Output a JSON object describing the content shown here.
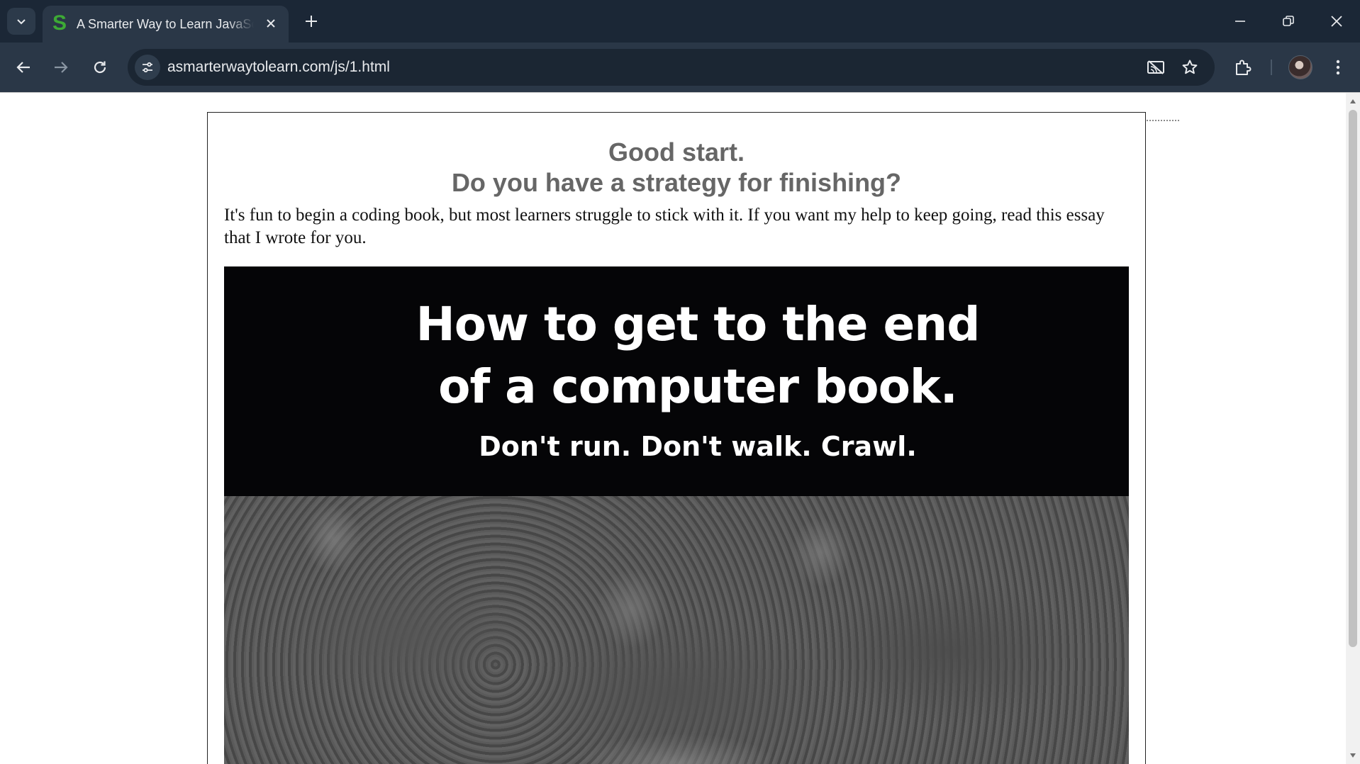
{
  "browser": {
    "tab": {
      "favicon": "S",
      "title": "A Smarter Way to Learn JavaScript"
    },
    "url": "asmarterwaytolearn.com/js/1.html",
    "icons": {
      "tab_search": "chevron-down-icon",
      "tab_close": "close-icon",
      "new_tab": "plus-icon",
      "minimize": "minimize-icon",
      "restore": "restore-icon",
      "close_window": "close-icon",
      "back": "back-arrow-icon",
      "forward": "forward-arrow-icon",
      "reload": "reload-icon",
      "site_info": "tune-icon",
      "cast_off": "cast-off-icon",
      "bookmark": "star-icon",
      "extensions": "puzzle-icon",
      "menu": "kebab-menu-icon"
    },
    "colors": {
      "tabbar": "#1b2736",
      "toolbar": "#2a3747",
      "omnibox": "#1b2633",
      "favicon": "#3daa35"
    }
  },
  "page": {
    "headline_line1": "Good start.",
    "headline_line2": "Do you have a strategy for finishing?",
    "intro": "It's fun to begin a coding book, but most learners struggle to stick with it. If you want my help to keep going, read this essay that I wrote for you.",
    "promo": {
      "title_line1": "How to get to the end",
      "title_line2": "of a computer book.",
      "subtitle": "Don't run. Don't walk. Crawl."
    },
    "colors": {
      "headline": "#666666",
      "promo_background": "#050507"
    }
  }
}
